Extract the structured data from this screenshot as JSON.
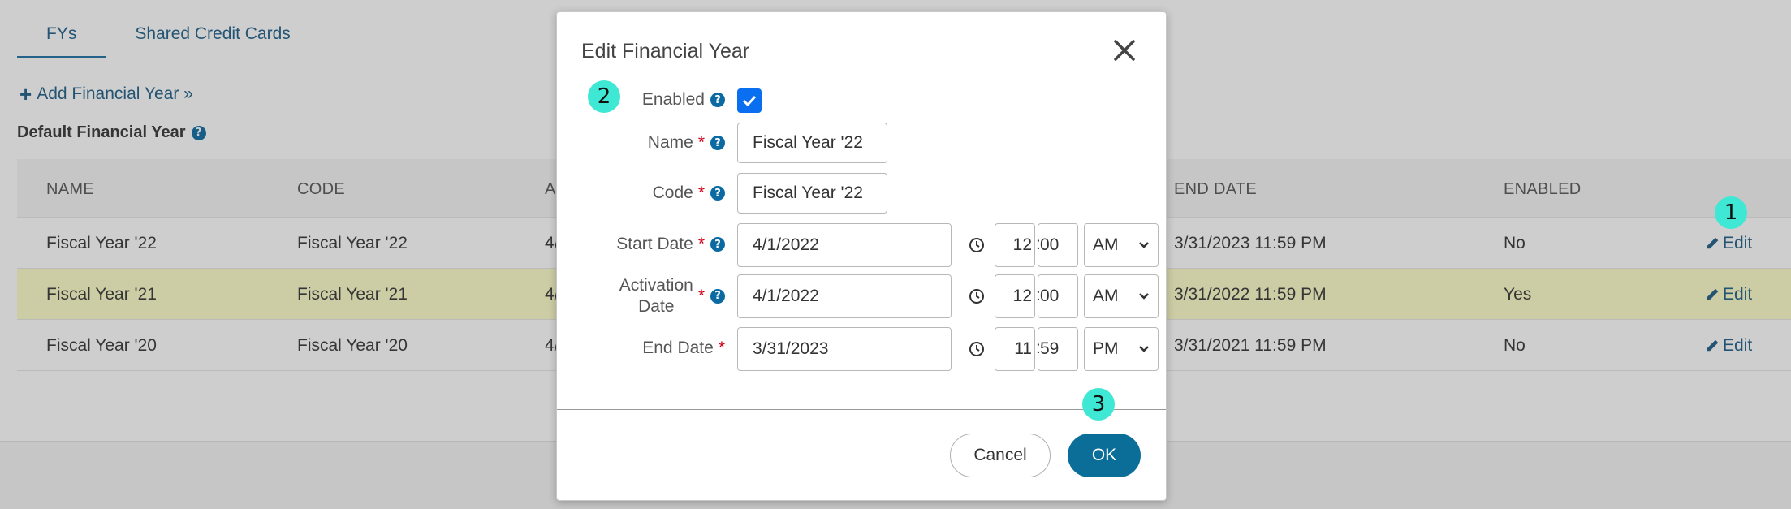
{
  "tabs": [
    {
      "label": "FYs"
    },
    {
      "label": "Shared Credit Cards"
    }
  ],
  "add_link": {
    "label": "Add Financial Year »"
  },
  "default_financial_year": {
    "label": "Default Financial Year"
  },
  "table": {
    "headers": [
      "NAME",
      "CODE",
      "A",
      "END DATE",
      "ENABLED"
    ],
    "rows": [
      {
        "name": "Fiscal Year '22",
        "code": "Fiscal Year '22",
        "start": "4/",
        "end": "3/31/2023 11:59 PM",
        "enabled": "No",
        "action": "Edit"
      },
      {
        "name": "Fiscal Year '21",
        "code": "Fiscal Year '21",
        "start": "4/",
        "end": "3/31/2022 11:59 PM",
        "enabled": "Yes",
        "action": "Edit"
      },
      {
        "name": "Fiscal Year '20",
        "code": "Fiscal Year '20",
        "start": "4/",
        "end": "3/31/2021 11:59 PM",
        "enabled": "No",
        "action": "Edit"
      }
    ]
  },
  "modal": {
    "title": "Edit Financial Year",
    "fields": {
      "enabled": {
        "label": "Enabled",
        "checked": true
      },
      "name": {
        "label": "Name",
        "value": "Fiscal Year '22"
      },
      "code": {
        "label": "Code",
        "value": "Fiscal Year '22"
      },
      "start_date": {
        "label": "Start Date",
        "date": "4/1/2022",
        "hour": "12",
        "minute": "00",
        "ampm": "AM"
      },
      "activation_date": {
        "label_line1": "Activation",
        "label_line2": "Date",
        "date": "4/1/2022",
        "hour": "12",
        "minute": "00",
        "ampm": "AM"
      },
      "end_date": {
        "label": "End Date",
        "date": "3/31/2023",
        "hour": "11",
        "minute": "59",
        "ampm": "PM"
      }
    },
    "buttons": {
      "cancel": "Cancel",
      "ok": "OK"
    }
  },
  "markers": [
    "1",
    "2",
    "3"
  ],
  "colors": {
    "accent": "#0a6e99",
    "link": "#1d5d86",
    "highlight_row": "#fdfcc9",
    "marker": "#3fe8d4",
    "required": "#d0021b"
  }
}
